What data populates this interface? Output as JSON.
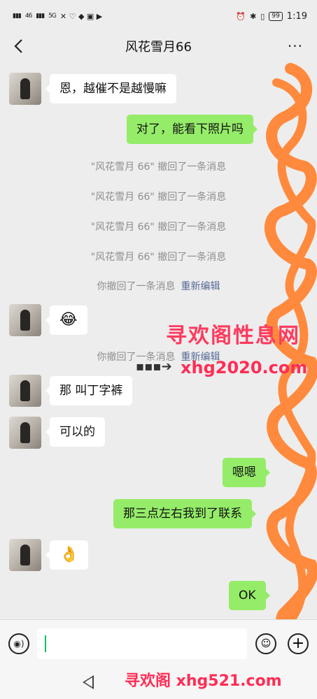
{
  "status_bar": {
    "signal_1": "46",
    "signal_2": "5G",
    "battery": "99",
    "time": "1:19"
  },
  "header": {
    "title": "风花雪月66",
    "more_label": "···"
  },
  "messages": [
    {
      "side": "in",
      "text": "恩，越催不是越慢嘛"
    },
    {
      "side": "out",
      "text": "对了，能看下照片吗"
    },
    {
      "type": "system",
      "text": "\"风花雪月 66\" 撤回了一条消息"
    },
    {
      "type": "system",
      "text": "\"风花雪月 66\" 撤回了一条消息"
    },
    {
      "type": "system",
      "text": "\"风花雪月 66\" 撤回了一条消息"
    },
    {
      "type": "system",
      "text": "\"风花雪月 66\" 撤回了一条消息"
    },
    {
      "type": "system",
      "text": "你撤回了一条消息",
      "link": "重新编辑"
    },
    {
      "side": "in",
      "text": "😂"
    },
    {
      "type": "system",
      "text": "你撤回了一条消息",
      "link": "重新编辑"
    },
    {
      "side": "in",
      "text": "那 叫丁字裤"
    },
    {
      "side": "in",
      "text": "可以的"
    },
    {
      "side": "out",
      "text": "嗯嗯"
    },
    {
      "side": "out",
      "text": "那三点左右我到了联系"
    },
    {
      "side": "in",
      "text": "👌"
    },
    {
      "side": "out",
      "text": "OK"
    }
  ],
  "watermarks": {
    "w1": "寻欢阁性息网",
    "w2": "xhg2020.com",
    "w3": "寻欢阁 xhg521.com"
  },
  "colors": {
    "background": "#ededed",
    "bubble_out": "#95ec69",
    "bubble_in": "#ffffff",
    "link": "#576b95",
    "scribble": "#ff8a3d"
  }
}
